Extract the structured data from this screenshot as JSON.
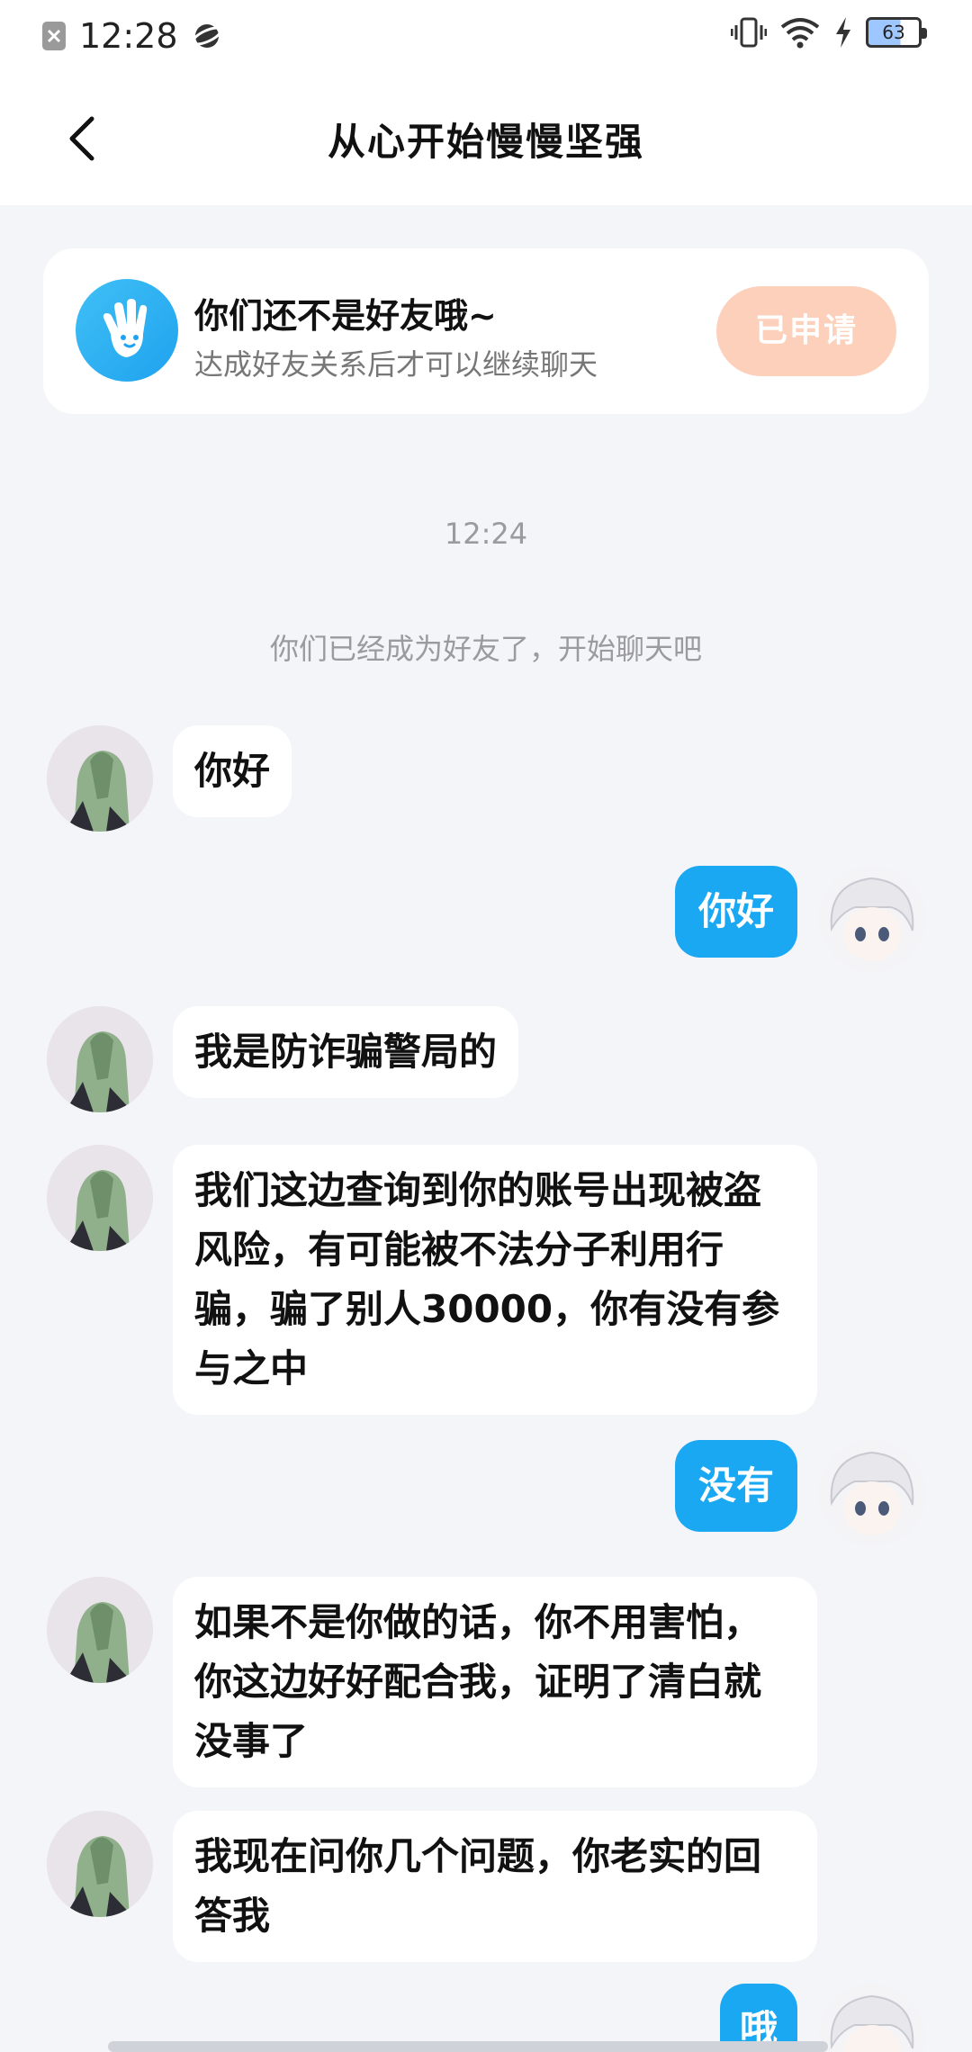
{
  "status_bar": {
    "time": "12:28",
    "battery": "63",
    "icons": [
      "notification-x-icon",
      "planet-icon",
      "vibrate-icon",
      "wifi-icon",
      "charging-bolt-icon",
      "battery-icon"
    ]
  },
  "nav": {
    "title": "从心开始慢慢坚强"
  },
  "friend_card": {
    "title": "你们还不是好友哦~",
    "subtitle": "达成好友关系后才可以继续聊天",
    "button_label": "已申请"
  },
  "timestamp": "12:24",
  "system_message": "你们已经成为好友了，开始聊天吧",
  "messages": [
    {
      "side": "left",
      "text": "你好"
    },
    {
      "side": "right",
      "text": "你好"
    },
    {
      "side": "left",
      "text": "我是防诈骗警局的"
    },
    {
      "side": "left",
      "text": "我们这边查询到你的账号出现被盗风险，有可能被不法分子利用行骗，骗了别人30000，你有没有参与之中"
    },
    {
      "side": "right",
      "text": "没有"
    },
    {
      "side": "left",
      "text": "如果不是你做的话，你不用害怕，你这边好好配合我，证明了清白就没事了"
    },
    {
      "side": "left",
      "text": "我现在问你几个问题，你老实的回答我"
    },
    {
      "side": "right",
      "text": "哦"
    }
  ],
  "colors": {
    "accent": "#1aa8f3",
    "background": "#f4f5f9",
    "applied_button": "#fdd0bb"
  }
}
